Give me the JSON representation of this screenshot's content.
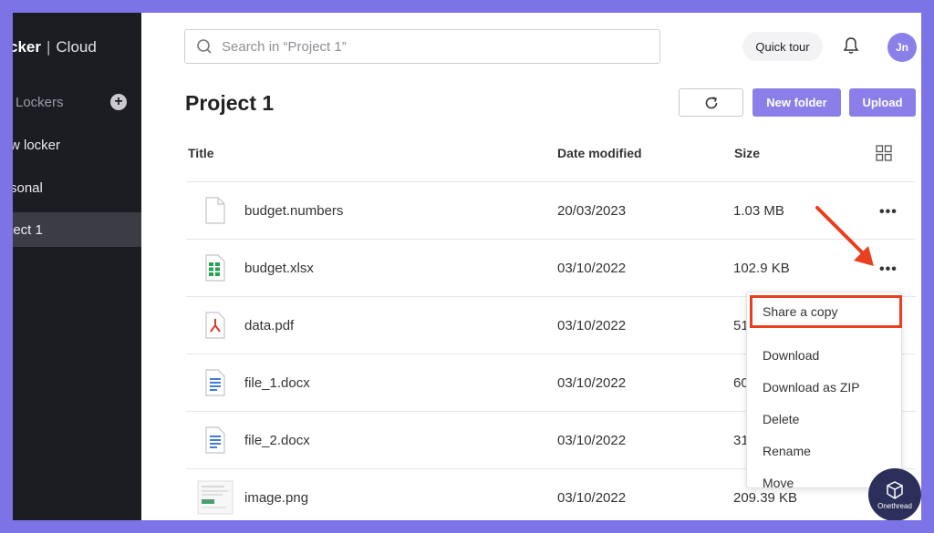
{
  "sidebar": {
    "brand_bold": "cker",
    "brand_sep": "|",
    "brand_light": "Cloud",
    "lockers_label": "Lockers",
    "add_label": "+",
    "items": [
      {
        "label": "w locker"
      },
      {
        "label": "sonal"
      },
      {
        "label": "ject 1"
      }
    ]
  },
  "header": {
    "search_placeholder": "Search in “Project 1”",
    "quick_tour": "Quick tour",
    "avatar_initials": "Jn"
  },
  "main": {
    "title": "Project 1",
    "new_folder": "New folder",
    "upload": "Upload",
    "columns": {
      "title": "Title",
      "date": "Date modified",
      "size": "Size"
    },
    "files": [
      {
        "name": "budget.numbers",
        "date": "20/03/2023",
        "size": "1.03 MB",
        "icon": "blank-file-icon"
      },
      {
        "name": "budget.xlsx",
        "date": "03/10/2022",
        "size": "102.9 KB",
        "icon": "spreadsheet-icon"
      },
      {
        "name": "data.pdf",
        "date": "03/10/2022",
        "size": "51",
        "icon": "pdf-icon"
      },
      {
        "name": "file_1.docx",
        "date": "03/10/2022",
        "size": "60",
        "icon": "document-icon"
      },
      {
        "name": "file_2.docx",
        "date": "03/10/2022",
        "size": "31",
        "icon": "document-icon"
      },
      {
        "name": "image.png",
        "date": "03/10/2022",
        "size": "209.39 KB",
        "icon": "image-thumbnail-icon"
      }
    ],
    "more_label": "•••"
  },
  "context_menu": {
    "items": [
      "Share a copy",
      "Download",
      "Download as ZIP",
      "Delete",
      "Rename",
      "Move"
    ]
  },
  "watermark": {
    "text": "Onethread"
  },
  "colors": {
    "accent": "#8a7fe8",
    "highlight": "#e8401f",
    "sidebar": "#1c1d22",
    "frame": "#7b73e6"
  }
}
